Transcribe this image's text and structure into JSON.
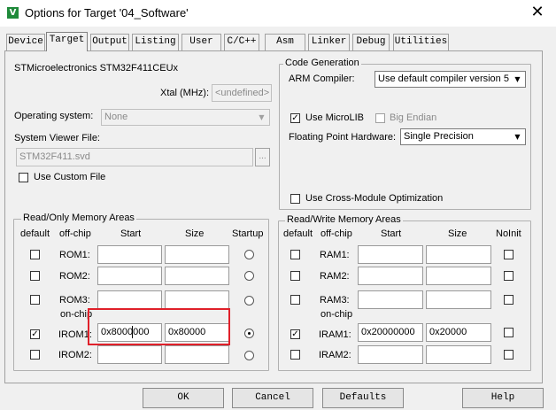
{
  "window": {
    "title": "Options for Target '04_Software'",
    "close_glyph": "✕",
    "app_icon_glyph": "V"
  },
  "tabs": [
    {
      "label": "Device",
      "active": false
    },
    {
      "label": "Target",
      "active": true
    },
    {
      "label": "Output",
      "active": false
    },
    {
      "label": "Listing",
      "active": false
    },
    {
      "label": "User",
      "active": false
    },
    {
      "label": "C/C++",
      "active": false
    },
    {
      "label": "Asm",
      "active": false
    },
    {
      "label": "Linker",
      "active": false
    },
    {
      "label": "Debug",
      "active": false
    },
    {
      "label": "Utilities",
      "active": false
    }
  ],
  "target": {
    "device_name": "STMicroelectronics STM32F411CEUx",
    "xtal_label": "Xtal (MHz):",
    "xtal_placeholder": "<undefined>",
    "os_label": "Operating system:",
    "os_value": "None",
    "svd_label": "System Viewer File:",
    "svd_value": "STM32F411.svd",
    "browse_label": "...",
    "custom_file_label": "Use Custom File",
    "custom_file_checked": false
  },
  "code_generation": {
    "title": "Code Generation",
    "compiler_label": "ARM Compiler:",
    "compiler_value": "Use default compiler version 5",
    "microlib_label": "Use MicroLIB",
    "microlib_checked": true,
    "big_endian_label": "Big Endian",
    "big_endian_checked": false,
    "fpu_label": "Floating Point Hardware:",
    "fpu_value": "Single Precision",
    "cross_module_label": "Use Cross-Module Optimization",
    "cross_module_checked": false
  },
  "ro_memory": {
    "title": "Read/Only Memory Areas",
    "headers": {
      "default": "default",
      "offchip": "off-chip",
      "start": "Start",
      "size": "Size",
      "startup": "Startup"
    },
    "onchip_label": "on-chip",
    "rows": [
      {
        "name": "ROM1:",
        "default": false,
        "start": "",
        "size": "",
        "startup": false
      },
      {
        "name": "ROM2:",
        "default": false,
        "start": "",
        "size": "",
        "startup": false
      },
      {
        "name": "ROM3:",
        "default": false,
        "start": "",
        "size": "",
        "startup": false
      },
      {
        "name": "IROM1:",
        "default": true,
        "start": "0x8000000",
        "size": "0x80000",
        "startup": true
      },
      {
        "name": "IROM2:",
        "default": false,
        "start": "",
        "size": "",
        "startup": false
      }
    ]
  },
  "rw_memory": {
    "title": "Read/Write Memory Areas",
    "headers": {
      "default": "default",
      "offchip": "off-chip",
      "start": "Start",
      "size": "Size",
      "noinit": "NoInit"
    },
    "onchip_label": "on-chip",
    "rows": [
      {
        "name": "RAM1:",
        "default": false,
        "start": "",
        "size": "",
        "noinit": false
      },
      {
        "name": "RAM2:",
        "default": false,
        "start": "",
        "size": "",
        "noinit": false
      },
      {
        "name": "RAM3:",
        "default": false,
        "start": "",
        "size": "",
        "noinit": false
      },
      {
        "name": "IRAM1:",
        "default": true,
        "start": "0x20000000",
        "size": "0x20000",
        "noinit": false
      },
      {
        "name": "IRAM2:",
        "default": false,
        "start": "",
        "size": "",
        "noinit": false
      }
    ]
  },
  "buttons": {
    "ok": "OK",
    "cancel": "Cancel",
    "defaults": "Defaults",
    "help": "Help"
  },
  "glyphs": {
    "check": "✓",
    "dropdown": "▼"
  },
  "colors": {
    "highlight": "#e0202a",
    "app_icon": "#1f8a3a"
  }
}
